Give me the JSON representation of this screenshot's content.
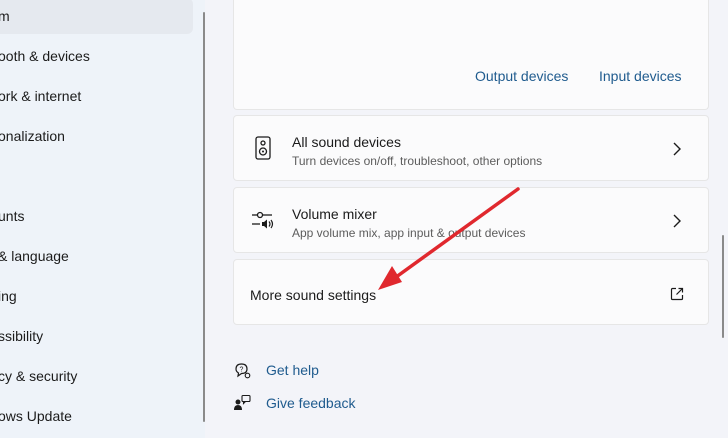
{
  "sidebar": {
    "items": [
      {
        "label": "m",
        "selected": true
      },
      {
        "label": "ooth & devices"
      },
      {
        "label": "ork & internet"
      },
      {
        "label": "onalization"
      },
      {
        "label": ""
      },
      {
        "label": "unts"
      },
      {
        "label": "& language"
      },
      {
        "label": "ing"
      },
      {
        "label": "ssibility"
      },
      {
        "label": "cy & security"
      },
      {
        "label": "ows Update"
      }
    ]
  },
  "output_card": {
    "output_devices_link": "Output devices",
    "input_devices_link": "Input devices"
  },
  "all_sound_devices": {
    "title": "All sound devices",
    "subtitle": "Turn devices on/off, troubleshoot, other options",
    "icon": "speaker-icon"
  },
  "volume_mixer": {
    "title": "Volume mixer",
    "subtitle": "App volume mix, app input & output devices",
    "icon": "volume-mixer-icon"
  },
  "more_sound_settings": {
    "title": "More sound settings",
    "icon": "external-link-icon"
  },
  "help": {
    "get_help": "Get help",
    "give_feedback": "Give feedback"
  },
  "colors": {
    "accent_link": "#1f5b8e",
    "annotation_arrow": "#e0282e"
  }
}
